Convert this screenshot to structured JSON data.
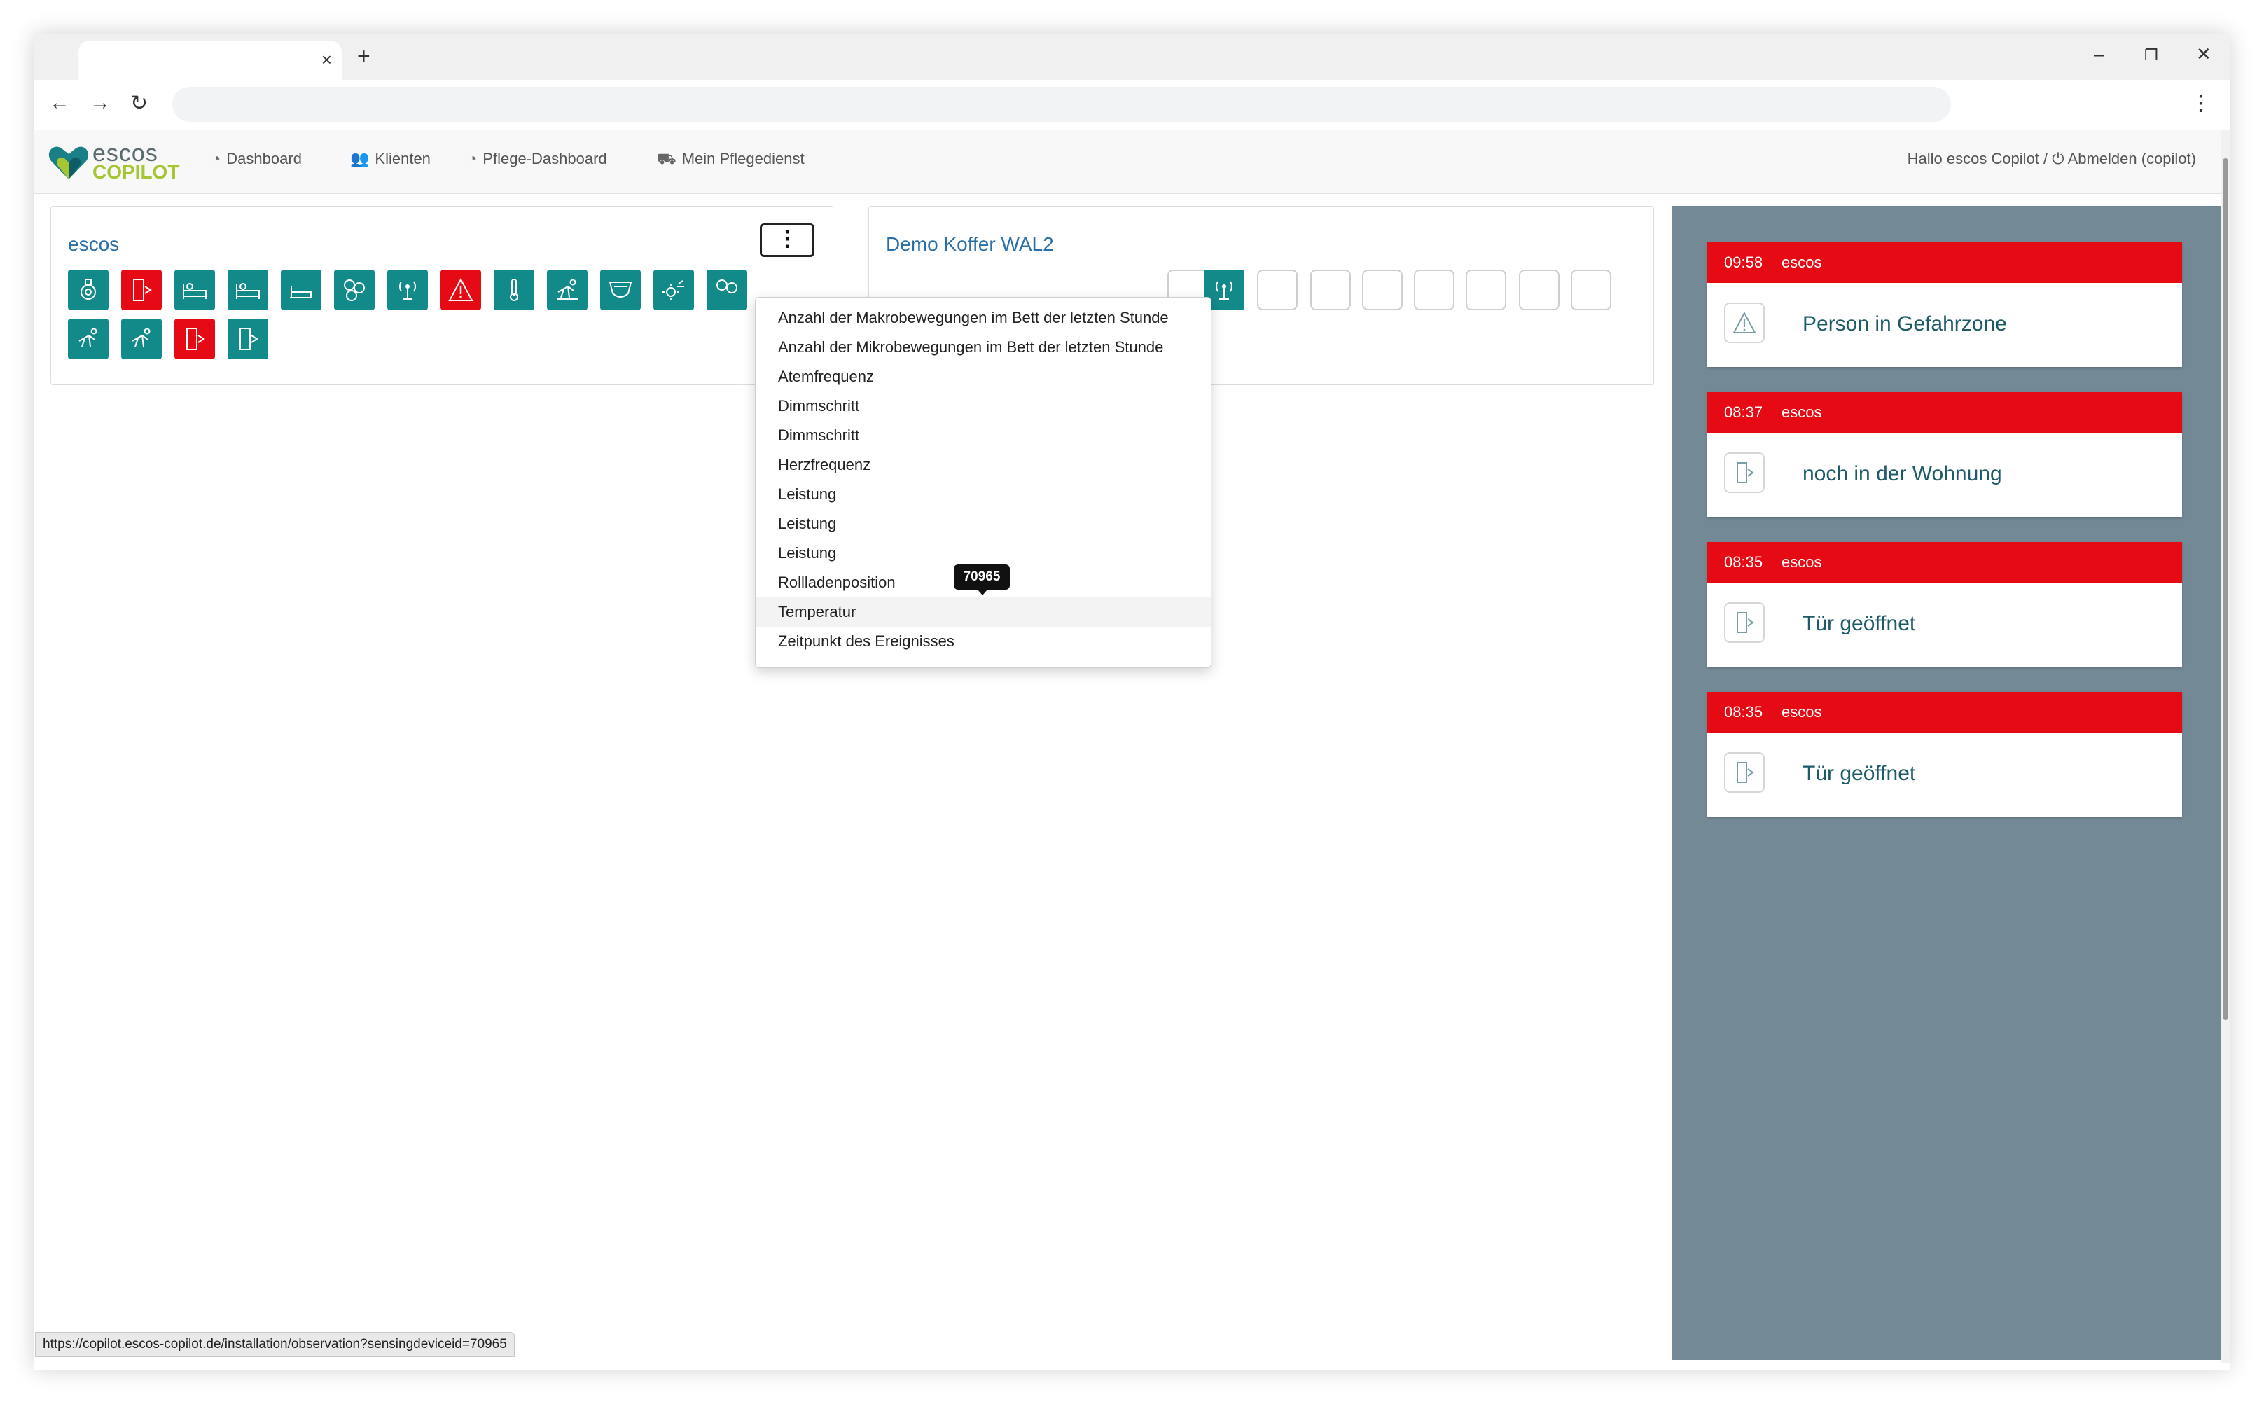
{
  "browser": {
    "tab_close": "×",
    "new_tab": "+",
    "minimize": "–",
    "restore": "❐",
    "close": "✕",
    "back": "←",
    "forward": "→",
    "reload": "↻",
    "menu": "⋮",
    "url": ""
  },
  "app": {
    "logo_line1": "escos",
    "logo_line2": "COPILOT",
    "nav": [
      {
        "label": "Dashboard",
        "icon": "gauge-icon"
      },
      {
        "label": "Klienten",
        "icon": "users-icon"
      },
      {
        "label": "Pflege-Dashboard",
        "icon": "gauge-icon"
      },
      {
        "label": "Mein Pflegedienst",
        "icon": "truck-icon"
      }
    ],
    "greeting": "Hallo escos Copilot / ",
    "logout": "⏻ Abmelden (copilot)"
  },
  "cards": [
    {
      "title": "escos",
      "kebab": "⋮"
    },
    {
      "title": "Demo Koffer WAL2"
    }
  ],
  "dropdown": {
    "items": [
      "Anzahl der Makrobewegungen im Bett der letzten Stunde",
      "Anzahl der Mikrobewegungen im Bett der letzten Stunde",
      "Atemfrequenz",
      "Dimmschritt",
      "Dimmschritt",
      "Herzfrequenz",
      "Leistung",
      "Leistung",
      "Leistung",
      "Rollladenposition",
      "Temperatur",
      "Zeitpunkt des Ereignisses"
    ],
    "hovered_index": 10
  },
  "tooltip": "70965",
  "alerts": [
    {
      "time": "09:58",
      "source": "escos",
      "message": "Person in Gefahrzone",
      "icon": "warning-icon"
    },
    {
      "time": "08:37",
      "source": "escos",
      "message": "noch in der Wohnung",
      "icon": "door-icon"
    },
    {
      "time": "08:35",
      "source": "escos",
      "message": "Tür geöffnet",
      "icon": "door-icon"
    },
    {
      "time": "08:35",
      "source": "escos",
      "message": "Tür geöffnet",
      "icon": "door-icon"
    }
  ],
  "status_url": "https://copilot.escos-copilot.de/installation/observation?sensingdeviceid=70965",
  "colors": {
    "teal": "#138a8a",
    "red": "#e60a14",
    "panel": "#738a96",
    "link": "#2a6fa8"
  }
}
